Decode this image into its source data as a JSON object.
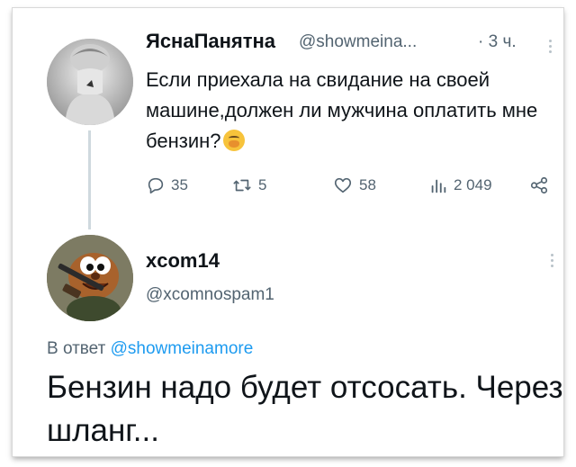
{
  "tweet1": {
    "name": "ЯснаПанятна",
    "handle": "@showmeina...",
    "time": "· 3 ч.",
    "text": "Если приехала на свидание на своей машине,должен ли мужчина оплатить мне бензин?",
    "emoji_icon": "face-with-hand-over-mouth-emoji",
    "actions": {
      "replies": "35",
      "retweets": "5",
      "likes": "58",
      "views": "2 049"
    }
  },
  "tweet2": {
    "name": "xcom14",
    "handle": "@xcomnospam1",
    "reply_prefix": "В ответ",
    "reply_mention": "@showmeinamore",
    "text": "Бензин надо будет отсосать. Через шланг..."
  },
  "colors": {
    "text": "#0f1419",
    "secondary": "#536471",
    "link": "#1d9bf0",
    "thread_line": "#cfd9de"
  },
  "icons": [
    "reply-icon",
    "retweet-icon",
    "like-icon",
    "views-icon",
    "share-icon",
    "more-options-icon"
  ]
}
